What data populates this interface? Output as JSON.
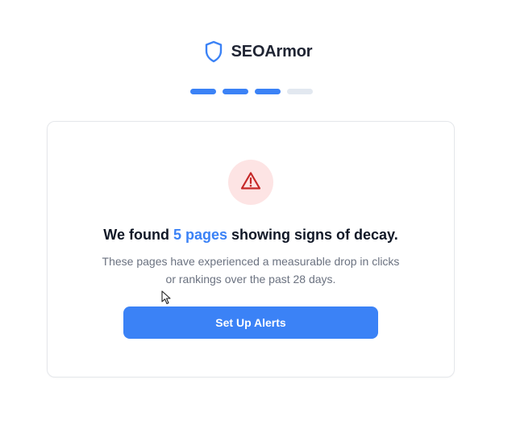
{
  "brand": {
    "name": "SEOArmor",
    "icon": "shield-icon",
    "accent_color": "#3b82f6"
  },
  "progress": {
    "total_steps": 4,
    "completed_steps": 3
  },
  "card": {
    "icon": "warning-icon",
    "headline_prefix": "We found ",
    "headline_highlight": "5 pages",
    "headline_suffix": " showing signs of decay.",
    "description": "These pages have experienced a measurable drop in clicks or rankings over the past 28 days.",
    "cta_label": "Set Up Alerts"
  },
  "colors": {
    "primary": "#3b82f6",
    "warning_bg": "#fde4e4",
    "warning_icon": "#c62828",
    "inactive_step": "#e2e8f0"
  }
}
